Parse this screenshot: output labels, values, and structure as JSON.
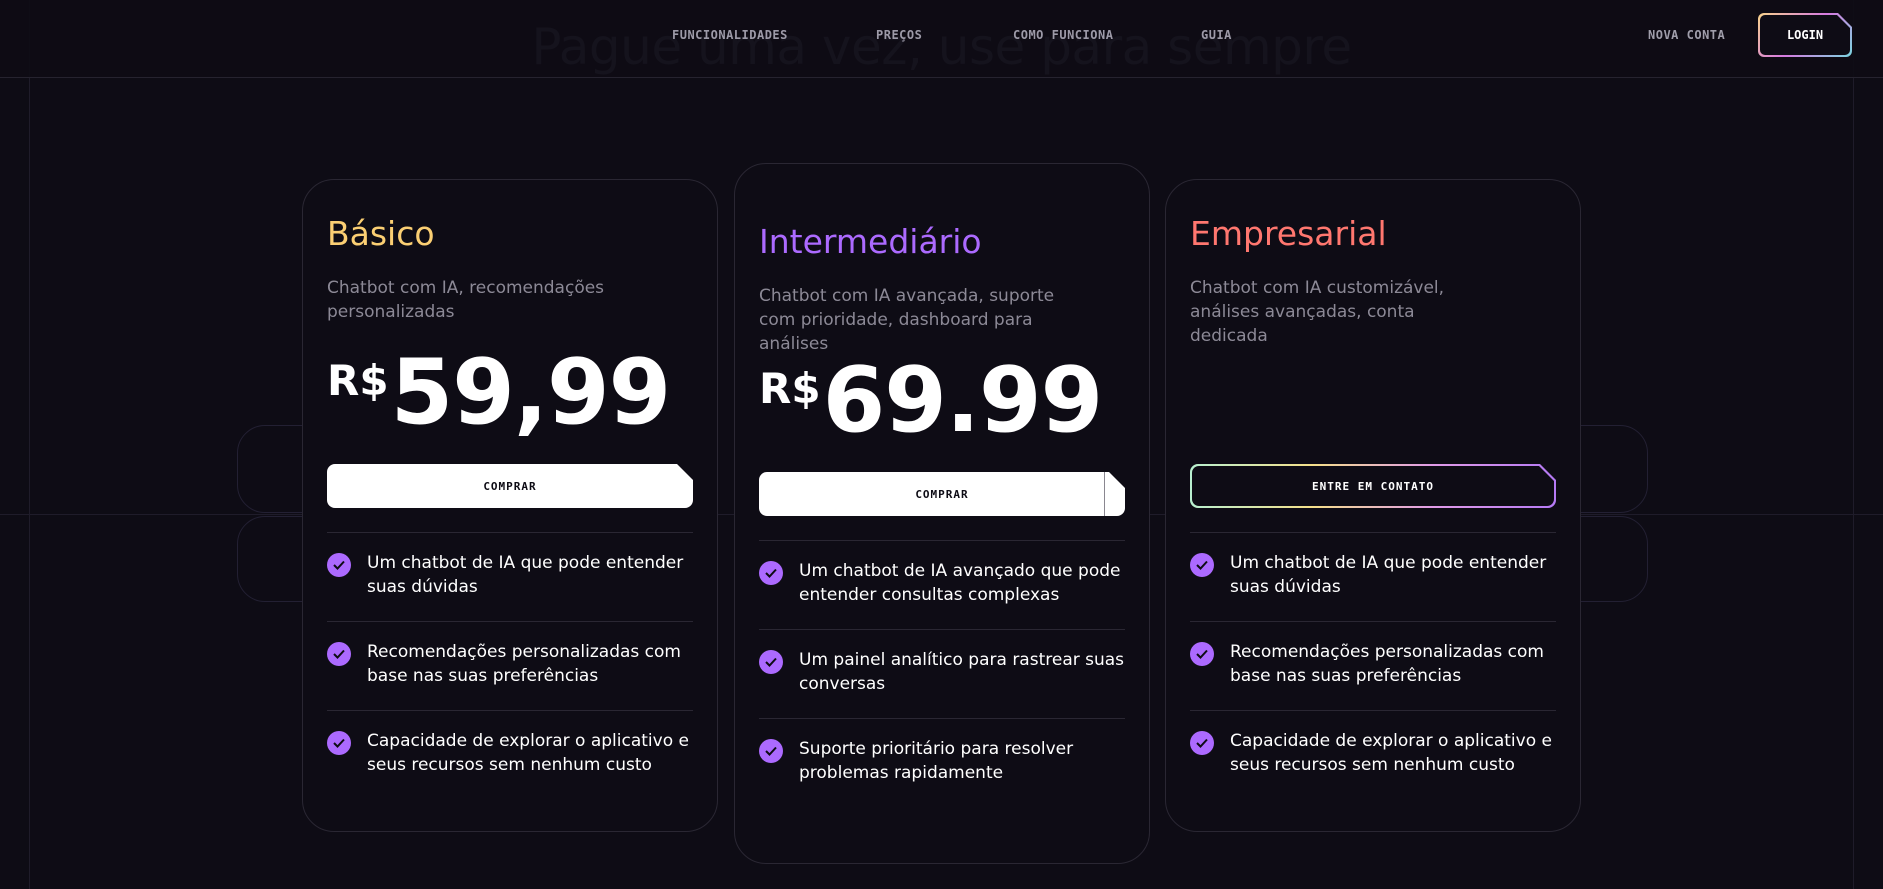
{
  "header": {
    "background_title": "Pague uma vez, use para sempre",
    "nav": [
      "FUNCIONALIDADES",
      "PREÇOS",
      "COMO FUNCIONA",
      "GUIA"
    ],
    "signup_label": "NOVA CONTA",
    "login_label": "LOGIN"
  },
  "plans": [
    {
      "name": "Básico",
      "color": "#fbcf73",
      "description": "Chatbot com IA, recomendações personalizadas",
      "currency": "R$",
      "price": "59,99",
      "button_label": "COMPRAR",
      "features": [
        "Um chatbot de IA que pode entender suas dúvidas",
        "Recomendações personalizadas com base nas suas preferências",
        "Capacidade de explorar o aplicativo e seus recursos sem nenhum custo"
      ]
    },
    {
      "name": "Intermediário",
      "color": "#ac6aff",
      "description": "Chatbot com IA avançada, suporte com prioridade, dashboard para análises",
      "currency": "R$",
      "price": "69.99",
      "button_label": "COMPRAR",
      "features": [
        "Um chatbot de IA avançado que pode entender consultas complexas",
        "Um painel analítico para rastrear suas conversas",
        "Suporte prioritário para resolver problemas rapidamente"
      ]
    },
    {
      "name": "Empresarial",
      "color": "#ff776f",
      "description": "Chatbot com IA customizável, análises avançadas, conta dedicada",
      "button_label": "ENTRE EM CONTATO",
      "features": [
        "Um chatbot de IA que pode entender suas dúvidas",
        "Recomendações personalizadas com base nas suas preferências",
        "Capacidade de explorar o aplicativo e seus recursos sem nenhum custo"
      ]
    }
  ]
}
